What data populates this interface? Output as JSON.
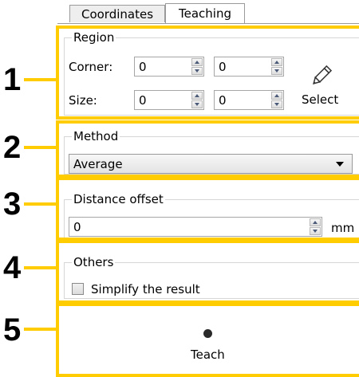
{
  "tabs": [
    {
      "label": "Coordinates",
      "active": false
    },
    {
      "label": "Teaching",
      "active": true
    }
  ],
  "region": {
    "legend": "Region",
    "corner_label": "Corner:",
    "size_label": "Size:",
    "corner_x": "0",
    "corner_y": "0",
    "size_x": "0",
    "size_y": "0",
    "select_label": "Select",
    "select_icon": "pencil-icon"
  },
  "method": {
    "legend": "Method",
    "selected": "Average"
  },
  "distance_offset": {
    "legend": "Distance offset",
    "value": "0",
    "unit": "mm"
  },
  "others": {
    "legend": "Others",
    "simplify_label": "Simplify the result",
    "simplify_checked": false
  },
  "teach": {
    "label": "Teach",
    "icon": "record-dot-icon"
  },
  "annotations": [
    "1",
    "2",
    "3",
    "4",
    "5"
  ],
  "colors": {
    "annotation": "#ffcc00"
  }
}
